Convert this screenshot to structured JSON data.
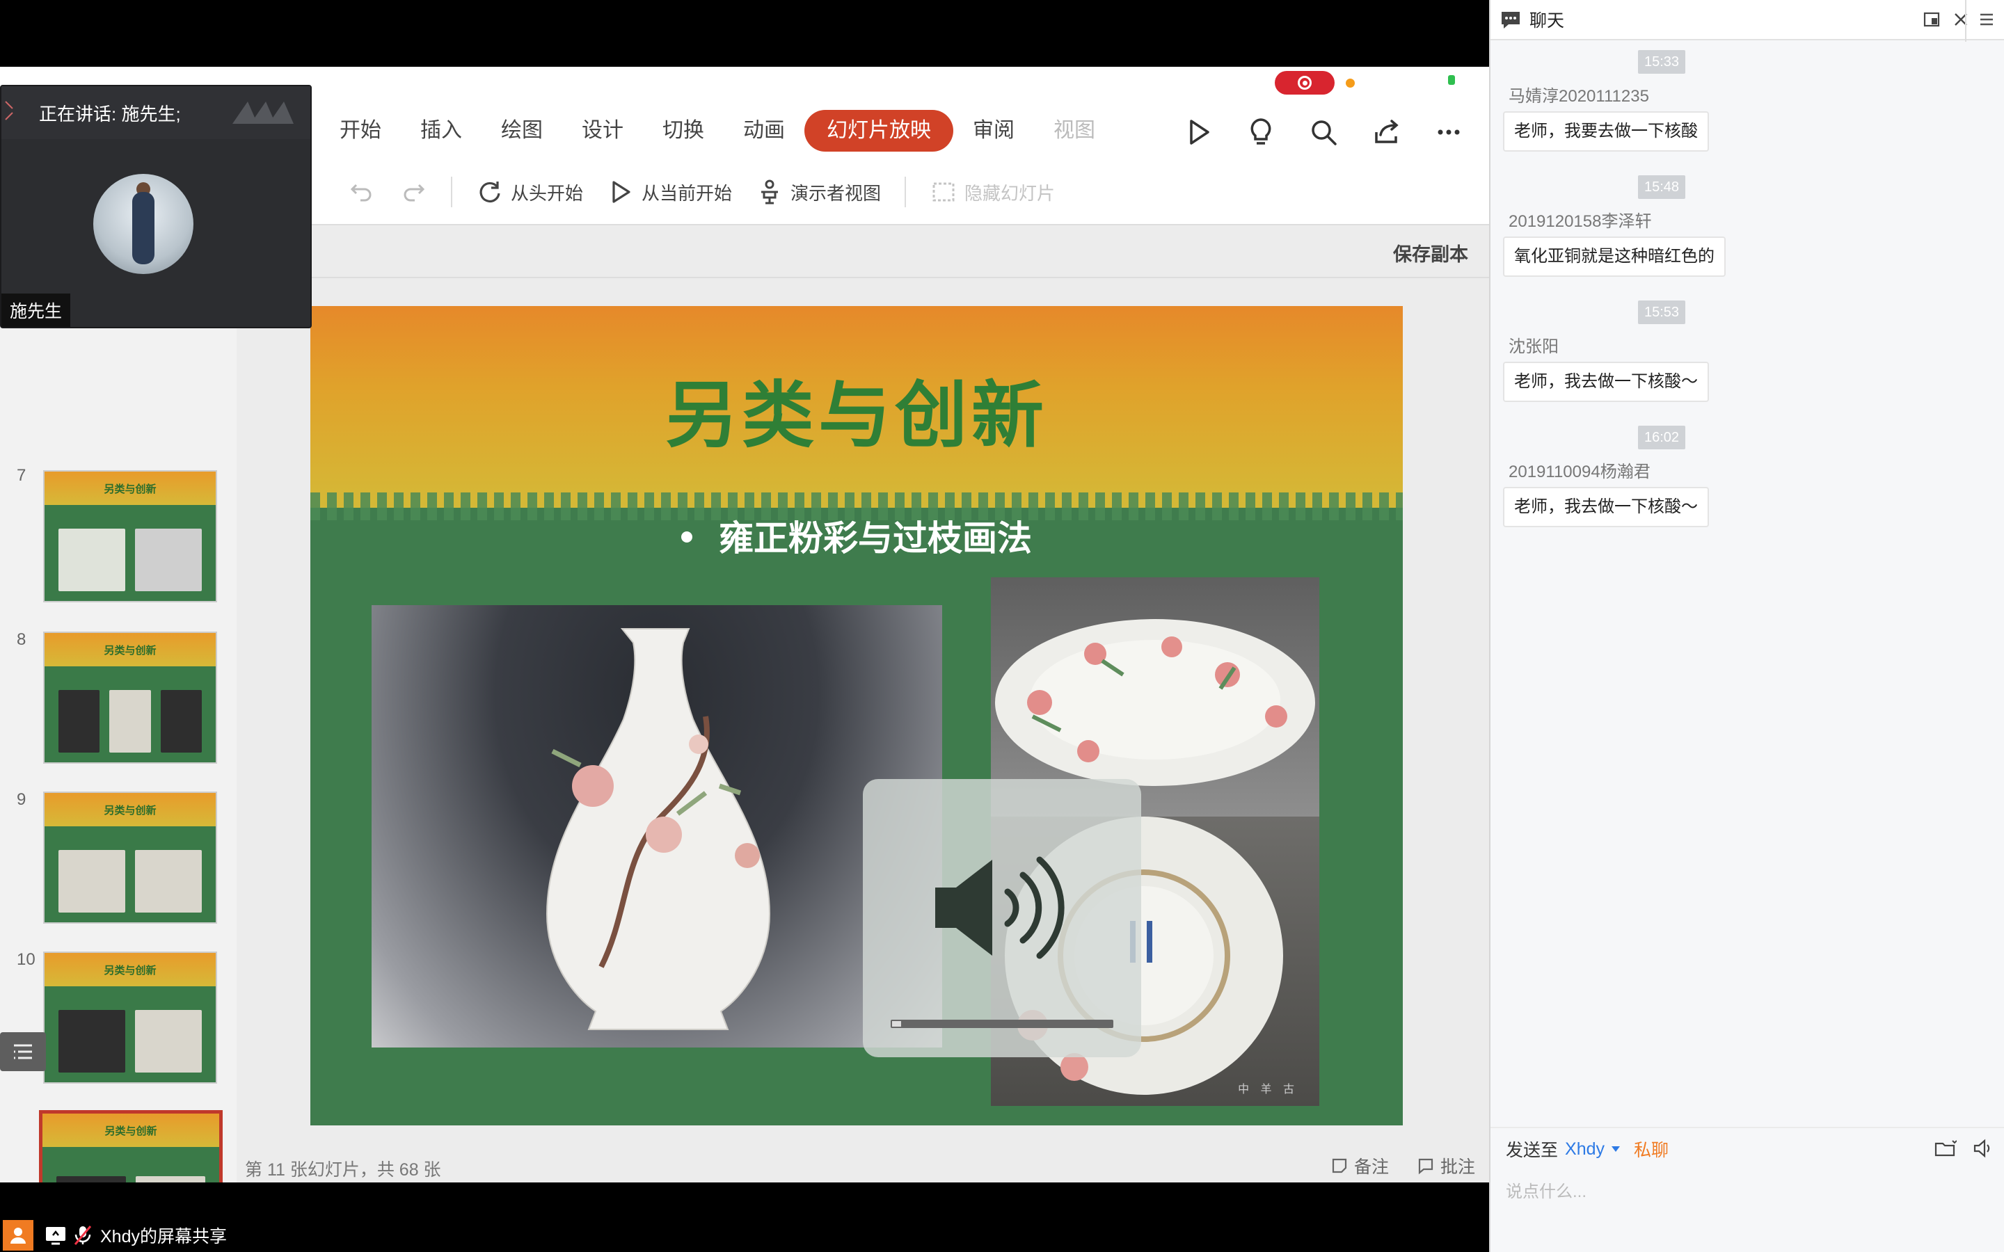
{
  "screen": {
    "speaking_label": "正在讲话: 施先生;",
    "speaker_name": "施先生",
    "ribbon_tabs": [
      "开始",
      "插入",
      "绘图",
      "设计",
      "切换",
      "动画",
      "幻灯片放映",
      "审阅",
      "视图"
    ],
    "active_tab": "幻灯片放映",
    "ribbon_icons": [
      "play-icon",
      "lightbulb-icon",
      "search-icon",
      "share-icon",
      "more-icon"
    ],
    "toolbar": {
      "from_start": "从头开始",
      "from_current": "从当前开始",
      "presenter_view": "演示者视图",
      "hide_slide": "隐藏幻灯片"
    },
    "save_copy": "保存副本",
    "thumbnails": [
      {
        "num": "7",
        "title": "另类与创新"
      },
      {
        "num": "8",
        "title": "另类与创新"
      },
      {
        "num": "9",
        "title": "另类与创新"
      },
      {
        "num": "10",
        "title": "另类与创新"
      },
      {
        "num": "",
        "title": "另类与创新"
      }
    ],
    "slide": {
      "title": "另类与创新",
      "bullet": "雍正粉彩与过枝画法",
      "watermark": "中 羊 古"
    },
    "status_text": "第 11 张幻灯片，共 68 张",
    "notes_label": "备注",
    "comments_label": "批注",
    "volume_level": 0.04,
    "share_title": "Xhdy的屏幕共享"
  },
  "chat": {
    "title": "聊天",
    "messages": [
      {
        "time": "15:33",
        "sender": "马婧淳2020111235",
        "text": "老师，我要去做一下核酸"
      },
      {
        "time": "15:48",
        "sender": "2019120158李泽轩",
        "text": "氧化亚铜就是这种暗红色的"
      },
      {
        "time": "15:53",
        "sender": "沈张阳",
        "text": "老师，我去做一下核酸～"
      },
      {
        "time": "16:02",
        "sender": "2019110094杨瀚君",
        "text": "老师，我去做一下核酸～"
      }
    ],
    "send_to_label": "发送至",
    "send_target": "Xhdy",
    "private_label": "私聊",
    "input_placeholder": "说点什么..."
  }
}
